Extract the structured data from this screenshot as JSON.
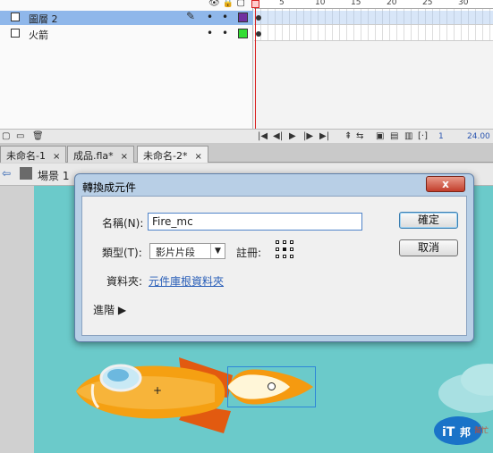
{
  "timeline": {
    "ruler_marks": [
      "5",
      "10",
      "15",
      "20",
      "25",
      "30"
    ],
    "layers": [
      {
        "name": "圖層 2",
        "selected": true,
        "color": "#7030a0"
      },
      {
        "name": "火箭",
        "selected": false,
        "color": "#33dd33"
      }
    ],
    "footer": {
      "frame": "1",
      "fps": "24.00"
    }
  },
  "tabs": [
    {
      "label": "未命名-1",
      "close": "×",
      "active": false
    },
    {
      "label": "成品.fla*",
      "close": "×",
      "active": false
    },
    {
      "label": "未命名-2*",
      "close": "×",
      "active": true
    }
  ],
  "editbar": {
    "scene_label": "場景 1"
  },
  "dialog": {
    "title": "轉換成元件",
    "close": "x",
    "name_label": "名稱(N):",
    "name_value": "Fire_mc",
    "type_label": "類型(T):",
    "type_value": "影片片段",
    "registration_label": "註冊:",
    "folder_label": "資料夾:",
    "folder_value": "元件庫根資料夾",
    "advanced_label": "進階",
    "ok_label": "確定",
    "cancel_label": "取消"
  },
  "watermark": {
    "text": "iT邦幫忙"
  },
  "colors": {
    "stage": "#6bcaca",
    "selection": "#8fb7ea",
    "accent": "#2e86d8"
  }
}
